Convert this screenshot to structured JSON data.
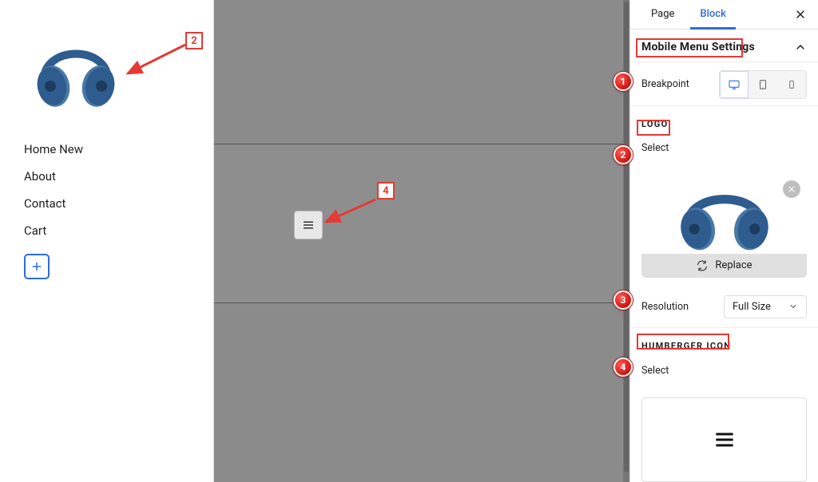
{
  "sidebar": {
    "menu": [
      "Home New",
      "About",
      "Contact",
      "Cart"
    ]
  },
  "panel": {
    "tabs": {
      "page": "Page",
      "block": "Block"
    },
    "accordion_title": "Mobile Menu Settings",
    "breakpoint": {
      "label": "Breakpoint"
    },
    "logo": {
      "heading": "LOGO",
      "select_label": "Select",
      "replace": "Replace",
      "resolution_label": "Resolution",
      "resolution_value": "Full Size"
    },
    "hamburger": {
      "heading": "HUMBERGER ICON",
      "select_label": "Select"
    }
  },
  "annotations": {
    "box2": "2",
    "box4": "4",
    "c1": "1",
    "c2": "2",
    "c3": "3",
    "c4": "4"
  }
}
